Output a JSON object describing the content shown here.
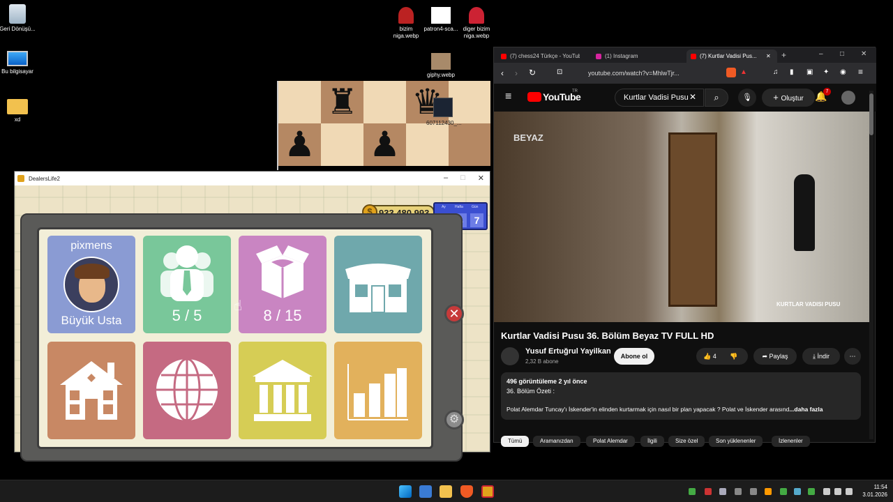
{
  "desktop": {
    "icons_left": [
      {
        "label": "Geri Dönüşü...",
        "icon": "recycle-bin-icon"
      },
      {
        "label": "Bu bilgisayar",
        "icon": "monitor-icon"
      },
      {
        "label": "xd",
        "icon": "folder-icon"
      }
    ],
    "icons_top": [
      {
        "label": "bizim niga.webp",
        "icon": "image-file-icon"
      },
      {
        "label": "patron4-sca...",
        "icon": "image-file-icon"
      },
      {
        "label": "diger bizim niga.webp",
        "icon": "image-file-icon"
      },
      {
        "label": "giphy.webp",
        "icon": "image-file-icon"
      }
    ],
    "floating_label": "607112430_..."
  },
  "dealers_window": {
    "title": "DealersLife2",
    "money": "933.480.993",
    "date_labels": [
      "Ay",
      "Hafta",
      "Gün"
    ],
    "date_values": [
      "94",
      "4",
      "7"
    ],
    "tiles": [
      {
        "name": "pixmens",
        "sub": "Büyük Usta",
        "color": "#8a9bd3"
      },
      {
        "value": "5 / 5",
        "color": "#79c79a"
      },
      {
        "value": "8 / 15",
        "color": "#c985c2"
      },
      {
        "icon": "shop-icon",
        "color": "#6fa8ac"
      },
      {
        "icon": "house-icon",
        "color": "#c88864"
      },
      {
        "icon": "globe-icon",
        "color": "#c56a82"
      },
      {
        "icon": "bank-icon",
        "color": "#d6cd55"
      },
      {
        "icon": "bar-chart-icon",
        "color": "#e2b15c"
      }
    ]
  },
  "browser": {
    "tabs": [
      {
        "label": "(7) chess24 Türkçe - YouTub..."
      },
      {
        "label": "(1) Instagram"
      },
      {
        "label": "(7) Kurtlar Vadisi Pus..."
      }
    ],
    "url": "youtube.com/watch?v=MhlwTjr...",
    "search_value": "Kurtlar Vadisi Pusu",
    "create_label": "Oluştur",
    "notif_count": "7",
    "yt_logo_text": "YouTube",
    "yt_region": "TR",
    "video_watermark": "BEYAZ",
    "video_caption": "KURTLAR VADISI PUSU",
    "title": "Kurtlar Vadisi Pusu 36. Bölüm Beyaz TV FULL HD",
    "channel": "Yusuf Ertuğrul Yayilkan",
    "subs": "2,32 B abone",
    "subscribe_label": "Abone ol",
    "likes": "4",
    "share_label": "Paylaş",
    "download_label": "İndir",
    "views_line": "496 görüntüleme  2 yıl önce",
    "desc_line1": "36. Bölüm Özeti :",
    "desc_line2": "Polat Alemdar Tuncay'ı İskender'in elinden kurtarmak için nasıl bir plan yapacak ? Polat ve İskender arasınd",
    "more_label": "...daha fazla",
    "chips": [
      "Tümü",
      "Aramanızdan",
      "Polat Alemdar",
      "İlgili",
      "Size özel",
      "Son yüklenenler",
      "İzlenenler"
    ]
  },
  "taskbar": {
    "time": "11:54",
    "date": "3.01.2026"
  }
}
